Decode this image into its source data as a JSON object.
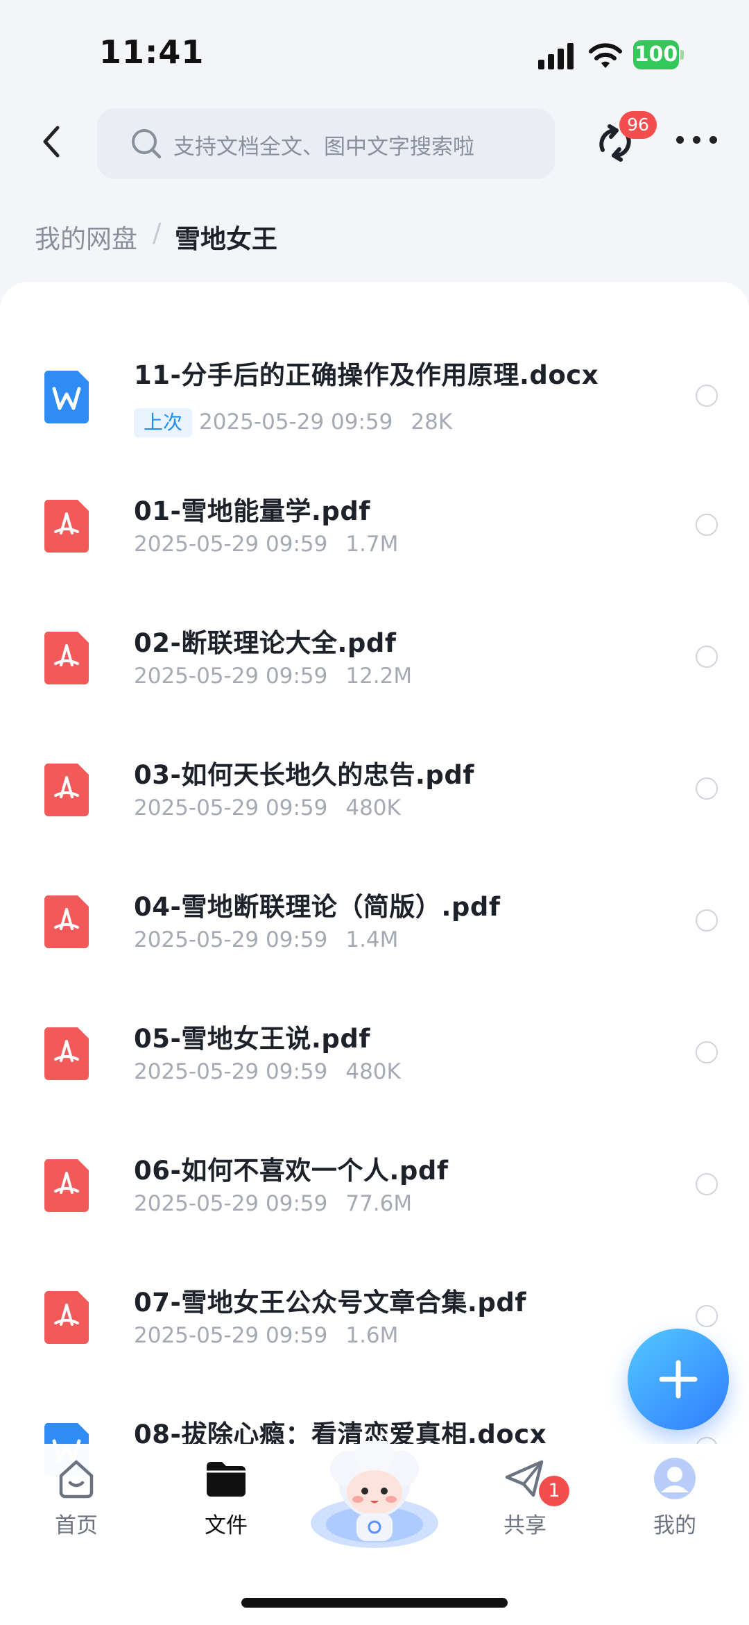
{
  "status_bar": {
    "time": "11:41",
    "battery": "100"
  },
  "header": {
    "search_placeholder": "支持文档全文、图中文字搜索啦",
    "sync_badge": "96"
  },
  "breadcrumb": {
    "root": "我的网盘",
    "separator": "/",
    "current": "雪地女王"
  },
  "files": [
    {
      "icon": "word-icon",
      "name": "11-分手后的正确操作及作用原理.docx",
      "tag": "上次",
      "date": "2025-05-29 09:59",
      "size": "28K"
    },
    {
      "icon": "pdf-icon",
      "name": "01-雪地能量学.pdf",
      "date": "2025-05-29 09:59",
      "size": "1.7M"
    },
    {
      "icon": "pdf-icon",
      "name": "02-断联理论大全.pdf",
      "date": "2025-05-29 09:59",
      "size": "12.2M"
    },
    {
      "icon": "pdf-icon",
      "name": "03-如何天长地久的忠告.pdf",
      "date": "2025-05-29 09:59",
      "size": "480K"
    },
    {
      "icon": "pdf-icon",
      "name": "04-雪地断联理论（简版）.pdf",
      "date": "2025-05-29 09:59",
      "size": "1.4M"
    },
    {
      "icon": "pdf-icon",
      "name": "05-雪地女王说.pdf",
      "date": "2025-05-29 09:59",
      "size": "480K"
    },
    {
      "icon": "pdf-icon",
      "name": "06-如何不喜欢一个人.pdf",
      "date": "2025-05-29 09:59",
      "size": "77.6M"
    },
    {
      "icon": "pdf-icon",
      "name": "07-雪地女王公众号文章合集.pdf",
      "date": "2025-05-29 09:59",
      "size": "1.6M"
    },
    {
      "icon": "word-icon",
      "name": "08-拔除心瘾：看清恋爱真相.docx",
      "date": "",
      "size": ""
    }
  ],
  "tabs": [
    {
      "label": "首页",
      "icon": "home-icon"
    },
    {
      "label": "文件",
      "icon": "folder-icon"
    },
    {
      "label": "共享",
      "icon": "share-icon",
      "badge": "1"
    },
    {
      "label": "我的",
      "icon": "profile-icon"
    }
  ],
  "colors": {
    "accent": "#2f7dff",
    "pdf": "#f25a5a",
    "word": "#2f8cf5",
    "badge": "#f44d4d"
  }
}
